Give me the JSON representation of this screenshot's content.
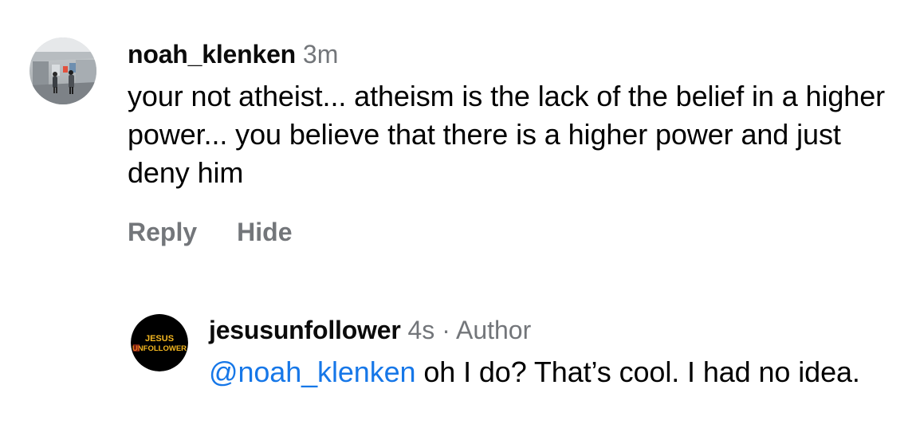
{
  "comment": {
    "username": "noah_klenken",
    "time": "3m",
    "text": "your not atheist... atheism is the lack of the belief in a higher power... you believe that there is a higher power and just deny him",
    "actions": {
      "reply": "Reply",
      "hide": "Hide"
    }
  },
  "reply": {
    "username": "jesusunfollower",
    "time": "4s",
    "separator": "·",
    "author_label": "Author",
    "mention": "@noah_klenken",
    "text": " oh I do? That’s cool. I had no idea.",
    "avatar_logo": [
      "JESUS",
      "UNFOLLOWER"
    ]
  },
  "colors": {
    "username": "#0b0b0b",
    "secondary": "#73767a",
    "mention": "#1677e8",
    "logo_background": "#000000",
    "logo_text": "#f5b820",
    "logo_accent": "#e23a1f"
  },
  "icons": {
    "commenter_avatar": "photo-avatar-icon",
    "author_avatar": "brand-logo-avatar-icon"
  }
}
